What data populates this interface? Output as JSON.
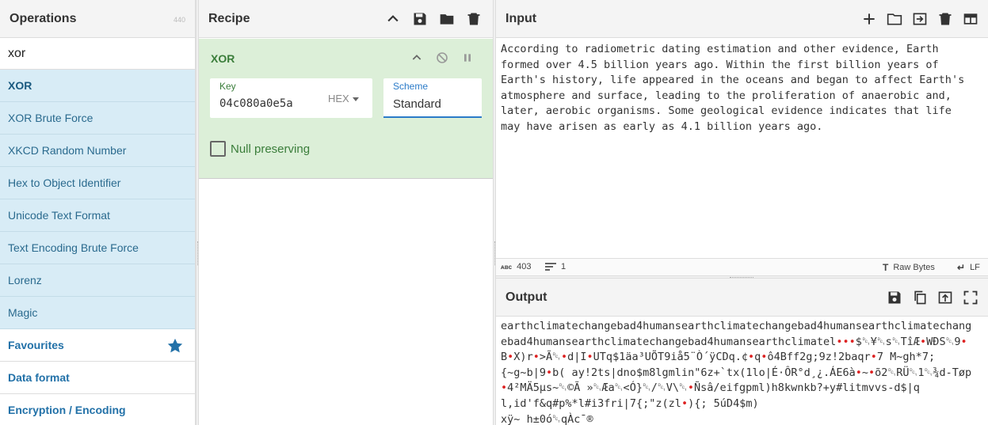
{
  "operations": {
    "title": "Operations",
    "count": "440",
    "search_value": "xor",
    "results": [
      {
        "label": "XOR"
      },
      {
        "label": "XOR Brute Force"
      },
      {
        "label": "XKCD Random Number"
      },
      {
        "label": "Hex to Object Identifier"
      },
      {
        "label": "Unicode Text Format"
      },
      {
        "label": "Text Encoding Brute Force"
      },
      {
        "label": "Lorenz"
      },
      {
        "label": "Magic"
      }
    ],
    "categories": [
      {
        "label": "Favourites"
      },
      {
        "label": "Data format"
      },
      {
        "label": "Encryption / Encoding"
      }
    ]
  },
  "recipe": {
    "title": "Recipe",
    "operation": {
      "name": "XOR",
      "key_label": "Key",
      "key_value": "04c080a0e5a",
      "key_format": "HEX",
      "scheme_label": "Scheme",
      "scheme_value": "Standard",
      "null_preserving_label": "Null preserving"
    }
  },
  "input": {
    "title": "Input",
    "text": "According to radiometric dating estimation and other evidence, Earth\nformed over 4.5 billion years ago. Within the first billion years of\nEarth's history, life appeared in the oceans and began to affect Earth's\natmosphere and surface, leading to the proliferation of anaerobic and,\nlater, aerobic organisms. Some geological evidence indicates that life\nmay have arisen as early as 4.1 billion years ago.",
    "status": {
      "length": "403",
      "lines": "1",
      "encoding": "Raw Bytes",
      "eol": "LF"
    }
  },
  "output": {
    "title": "Output",
    "lines": [
      "earthclimatechangebad4humansearthclimatechangebad4humansearthclimatechang",
      "ebad4humansearthclimatechangebad4humansearthclimatel•••$␑¥␑s␑TîÆ•WÐS␑9•",
      "B•X)r•>Ã␑•d|I•UTq$1äa³UÕT9iå5¨Ò´ÿCDq.¢•q•ô4Bff2g;9z!2baqr•7 M~gh*7;",
      "{~g~b|9•b( ay!2ts|dno$m8lgmlin\"6z+`tx(1lo|É·ÔR°d¸¿.ÁE6à•~•õ2␑RÜ␑1␑¾d-Tøp",
      "•4²MÄ5µs~␑©Ã »␑Æa␑<Ó}␑/␑V\\␑•Ñsâ/eifgpml)h8kwnkb?+y#litmvvs-d$|q",
      "l,id'f&q#p%*l#i3fri|7{;\"z(zl•){; 5úD4$m)",
      "xÿ~ h±0ó␑qÀc¯®"
    ]
  }
}
